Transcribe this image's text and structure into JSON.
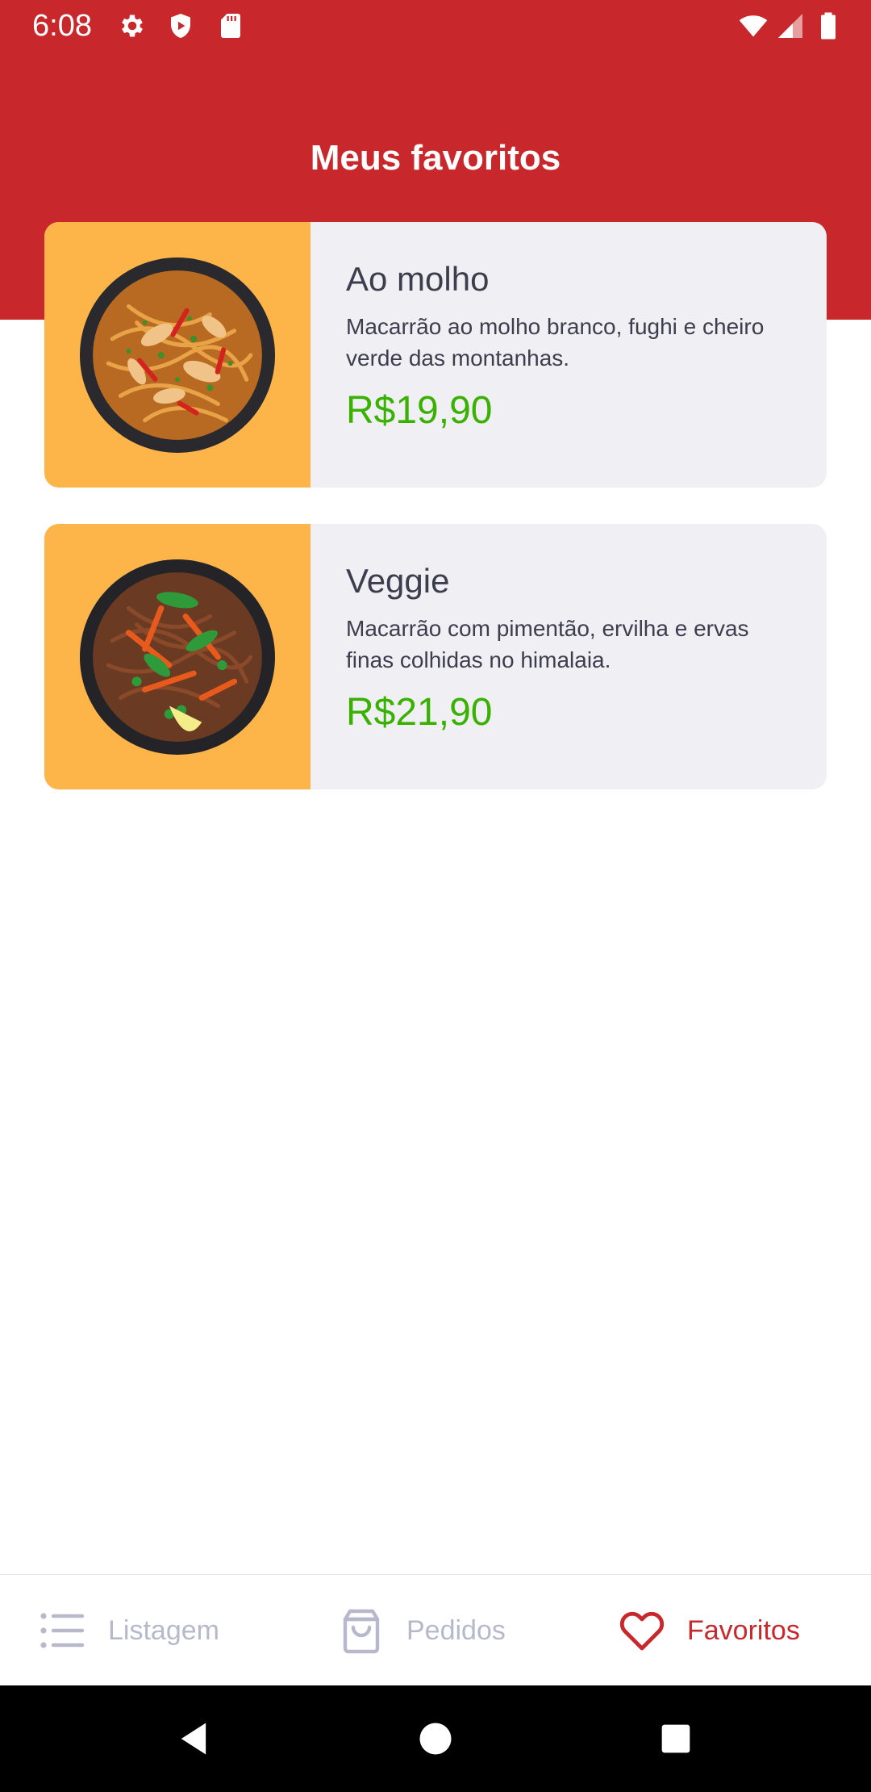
{
  "status_bar": {
    "time": "6:08",
    "icons": [
      "gear-icon",
      "shield-play-icon",
      "sd-card-icon",
      "wifi-icon",
      "signal-icon",
      "battery-icon"
    ]
  },
  "header": {
    "title": "Meus favoritos"
  },
  "favorites": [
    {
      "name": "Ao molho",
      "description": "Macarrão ao molho branco, fughi e cheiro verde das montanhas.",
      "price": "R$19,90",
      "image": "pasta-bowl-with-chicken"
    },
    {
      "name": "Veggie",
      "description": "Macarrão com pimentão, ervilha e ervas finas colhidas no himalaia.",
      "price": "R$21,90",
      "image": "pasta-bowl-with-vegetables"
    }
  ],
  "bottom_nav": {
    "items": [
      {
        "label": "Listagem",
        "icon": "list-icon",
        "active": false
      },
      {
        "label": "Pedidos",
        "icon": "shopping-bag-icon",
        "active": false
      },
      {
        "label": "Favoritos",
        "icon": "heart-icon",
        "active": true
      }
    ]
  },
  "system_nav": {
    "icons": [
      "back-icon",
      "home-icon",
      "recents-icon"
    ]
  },
  "colors": {
    "primary": "#c8282b",
    "card_background": "#f0eff4",
    "image_background": "#fdb54a",
    "price": "#39b100",
    "text": "#3d3d4e",
    "inactive_nav": "#b8b8cc"
  }
}
